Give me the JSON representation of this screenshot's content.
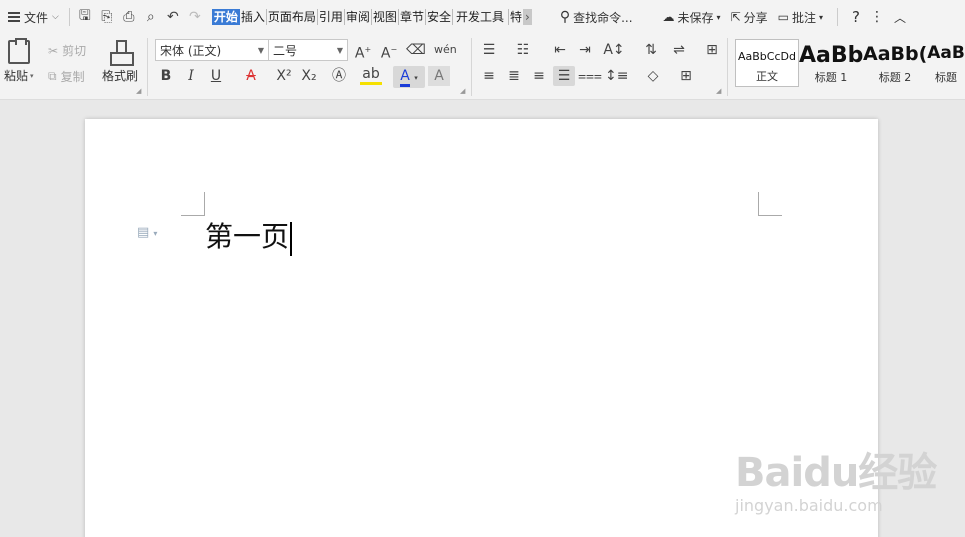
{
  "menubar": {
    "file_label": "文件",
    "tabs": [
      "开始",
      "插入",
      "页面布局",
      "引用",
      "审阅",
      "视图",
      "章节",
      "安全",
      "开发工具",
      "特"
    ],
    "active_tab": "开始",
    "search_label": "查找命令...",
    "unsaved_label": "未保存",
    "share_label": "分享",
    "comment_label": "批注",
    "help_symbol": "?"
  },
  "ribbon": {
    "paste_label": "粘贴",
    "cut_label": "剪切",
    "copy_label": "复制",
    "format_painter_label": "格式刷",
    "font_name": "宋体 (正文)",
    "font_size": "二号",
    "styles": [
      {
        "preview": "AaBbCcDd",
        "name": "正文"
      },
      {
        "preview": "AaBb",
        "name": "标题 1"
      },
      {
        "preview": "AaBb(",
        "name": "标题 2"
      },
      {
        "preview": "AaB",
        "name": "标题"
      }
    ]
  },
  "document": {
    "text": "第一页"
  },
  "watermark": {
    "brand": "Baidu经验",
    "url": "jingyan.baidu.com"
  },
  "colors": {
    "accent": "#3a7bd5",
    "font_color_underline": "#1a3cd8",
    "highlight_underline": "#f5e000",
    "strike_color": "#d33"
  }
}
